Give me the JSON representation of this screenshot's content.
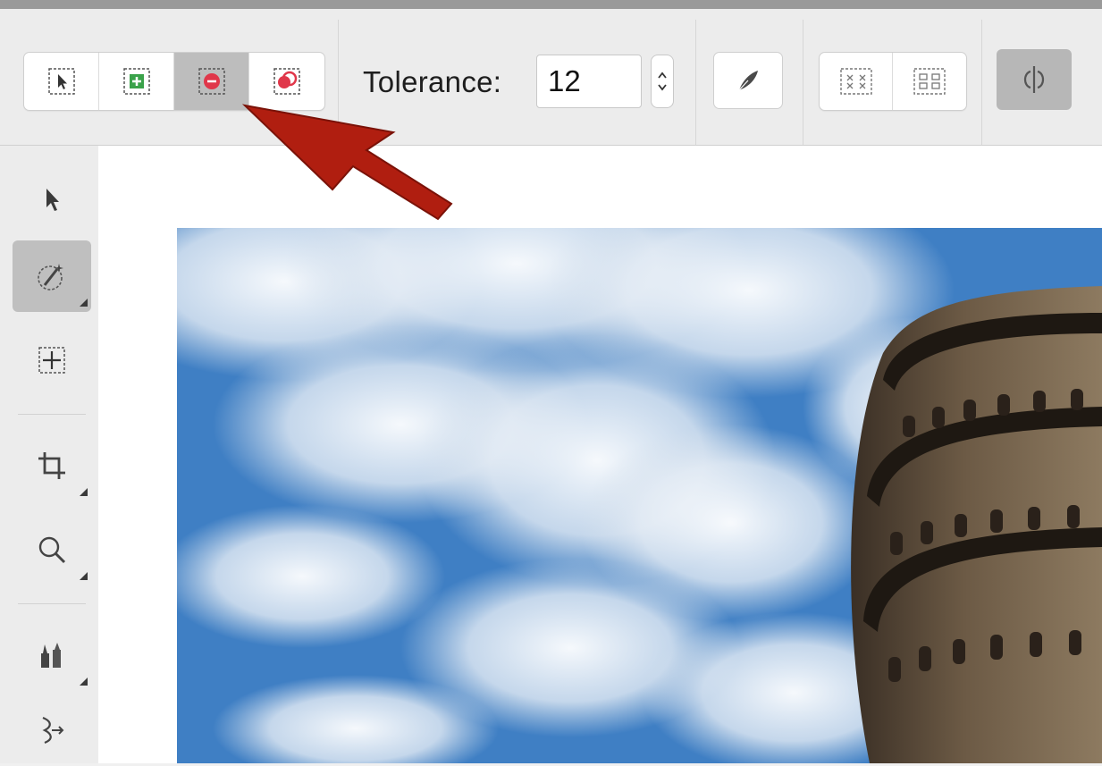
{
  "toolbar": {
    "selection_modes": [
      {
        "icon": "new-selection-icon"
      },
      {
        "icon": "add-to-selection-icon"
      },
      {
        "icon": "subtract-from-selection-icon",
        "active": true
      },
      {
        "icon": "intersect-selection-icon"
      }
    ],
    "tolerance": {
      "label": "Tolerance:",
      "value": "12"
    },
    "buttons": [
      {
        "icon": "feather-icon"
      },
      {
        "icon": "select-similar-icon"
      },
      {
        "icon": "select-contiguous-icon"
      },
      {
        "icon": "refine-edge-toggle-icon",
        "active": true
      }
    ]
  },
  "tools": [
    {
      "icon": "arrow-pointer-icon"
    },
    {
      "icon": "magic-wand-icon",
      "active": true
    },
    {
      "icon": "transform-selection-icon"
    },
    {
      "icon": "crop-icon"
    },
    {
      "icon": "zoom-icon"
    },
    {
      "icon": "paint-tools-icon"
    },
    {
      "icon": "retouch-icon"
    }
  ],
  "colors": {
    "accent_arrow": "#b01e10",
    "active_button": "#bdbdbd",
    "sky": "#3f7fc4",
    "tower": "#4a3a2c"
  }
}
